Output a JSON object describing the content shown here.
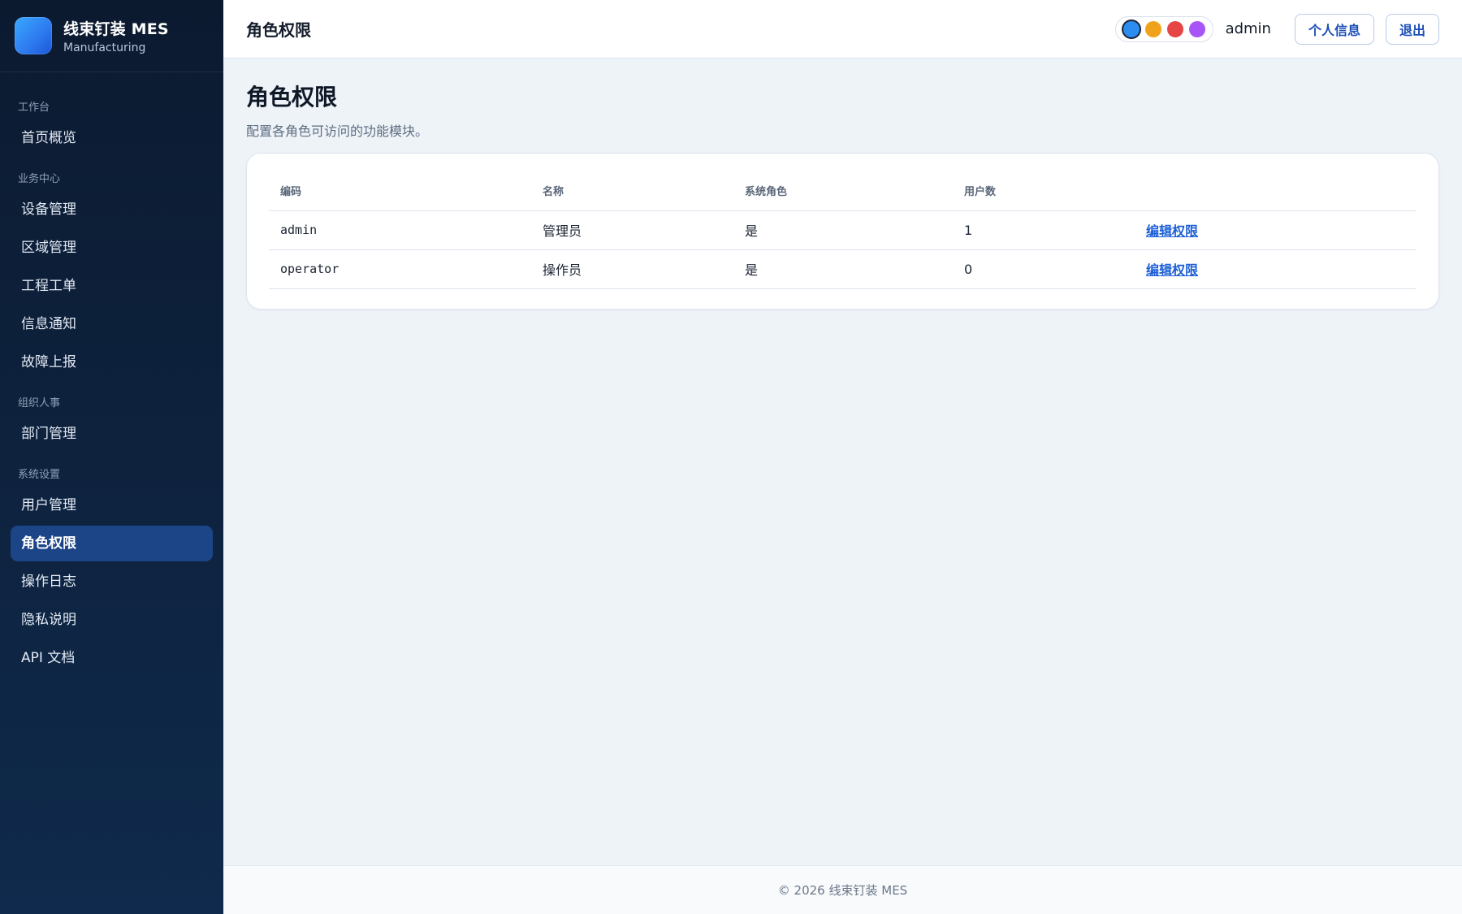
{
  "brand": {
    "title": "线束钉装 MES",
    "subtitle": "Manufacturing"
  },
  "sidebar": {
    "sections": [
      {
        "label": "工作台",
        "items": [
          {
            "label": "首页概览"
          }
        ]
      },
      {
        "label": "业务中心",
        "items": [
          {
            "label": "设备管理"
          },
          {
            "label": "区域管理"
          },
          {
            "label": "工程工单"
          },
          {
            "label": "信息通知"
          },
          {
            "label": "故障上报"
          }
        ]
      },
      {
        "label": "组织人事",
        "items": [
          {
            "label": "部门管理"
          }
        ]
      },
      {
        "label": "系统设置",
        "items": [
          {
            "label": "用户管理"
          },
          {
            "label": "角色权限",
            "active": true
          },
          {
            "label": "操作日志"
          },
          {
            "label": "隐私说明"
          },
          {
            "label": "API 文档"
          }
        ]
      }
    ]
  },
  "header": {
    "title": "角色权限",
    "theme_swatches": [
      {
        "name": "blue",
        "color": "#2d8cf0",
        "selected": true
      },
      {
        "name": "amber",
        "color": "#f0a31a",
        "selected": false
      },
      {
        "name": "red",
        "color": "#e64545",
        "selected": false
      },
      {
        "name": "purple",
        "color": "#a855f7",
        "selected": false
      }
    ],
    "username": "admin",
    "profile_label": "个人信息",
    "logout_label": "退出"
  },
  "page": {
    "title": "角色权限",
    "description": "配置各角色可访问的功能模块。"
  },
  "roles_table": {
    "columns": [
      "编码",
      "名称",
      "系统角色",
      "用户数",
      ""
    ],
    "rows": [
      {
        "code": "admin",
        "name": "管理员",
        "system": "是",
        "users": "1",
        "action": "编辑权限"
      },
      {
        "code": "operator",
        "name": "操作员",
        "system": "是",
        "users": "0",
        "action": "编辑权限"
      }
    ]
  },
  "footer": {
    "text": "© 2026 线束钉装 MES"
  }
}
